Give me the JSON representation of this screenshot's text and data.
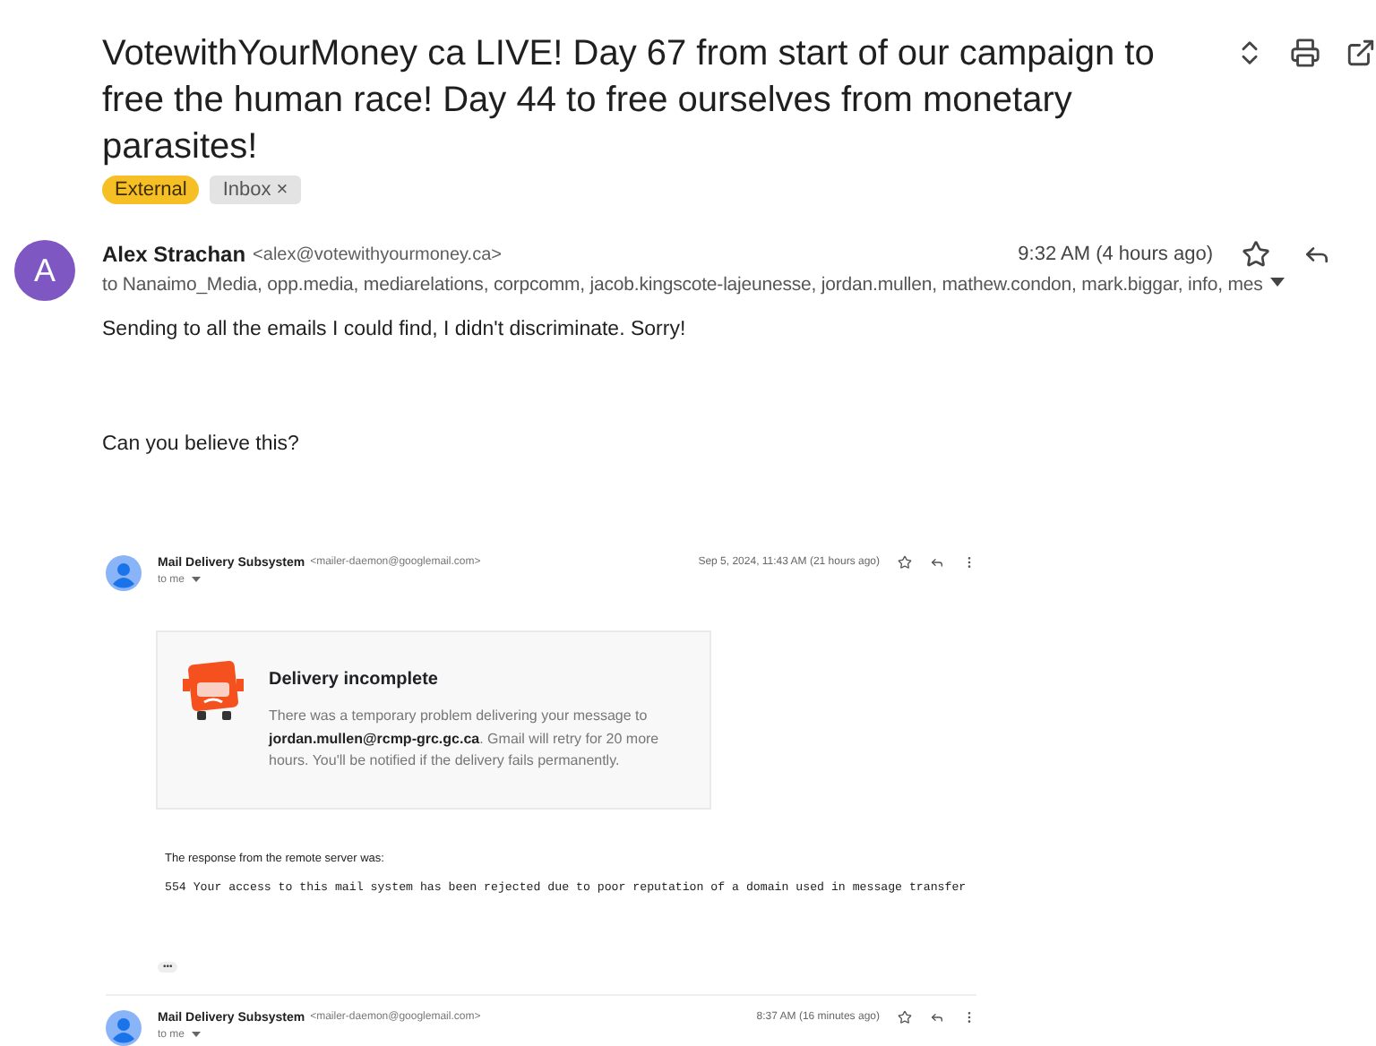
{
  "subject": "VotewithYourMoney ca LIVE! Day 67 from start of our campaign to free the human race! Day 44 to free ourselves from monetary parasites!",
  "labels": [
    {
      "text": "External",
      "kind": "external"
    },
    {
      "text": "Inbox",
      "kind": "inbox",
      "remove": "×"
    }
  ],
  "message": {
    "avatar_letter": "A",
    "sender": "Alex Strachan",
    "email": "<alex@votewithyourmoney.ca>",
    "time": "9:32 AM (4 hours ago)",
    "recipients": "to Nanaimo_Media, opp.media, mediarelations, corpcomm, jacob.kingscote-lajeunesse, jordan.mullen, mathew.condon, mark.biggar, info, mes",
    "body": [
      "Sending to all the emails I could find, I didn't discriminate.  Sorry!",
      "Can you believe this?"
    ]
  },
  "bounce": {
    "sender": "Mail Delivery Subsystem",
    "email": "<mailer-daemon@googlemail.com>",
    "time": "Sep 5, 2024, 11:43 AM (21 hours ago)",
    "to": "to me",
    "title": "Delivery incomplete",
    "text": "There was a temporary problem delivering your message to **jordan.mullen@rcmp-grc.gc.ca**. Gmail will retry for 20 more hours. You'll be notified if the delivery fails permanently.",
    "response_label": "The response from the remote server was:",
    "response_code": "554 Your access to this mail system has been rejected due to poor reputation of a domain used in message transfer",
    "ellipsis": "•••"
  },
  "next": {
    "sender": "Mail Delivery Subsystem",
    "email": "<mailer-daemon@googlemail.com>",
    "time": "8:37 AM (16 minutes ago)",
    "to": "to me"
  }
}
